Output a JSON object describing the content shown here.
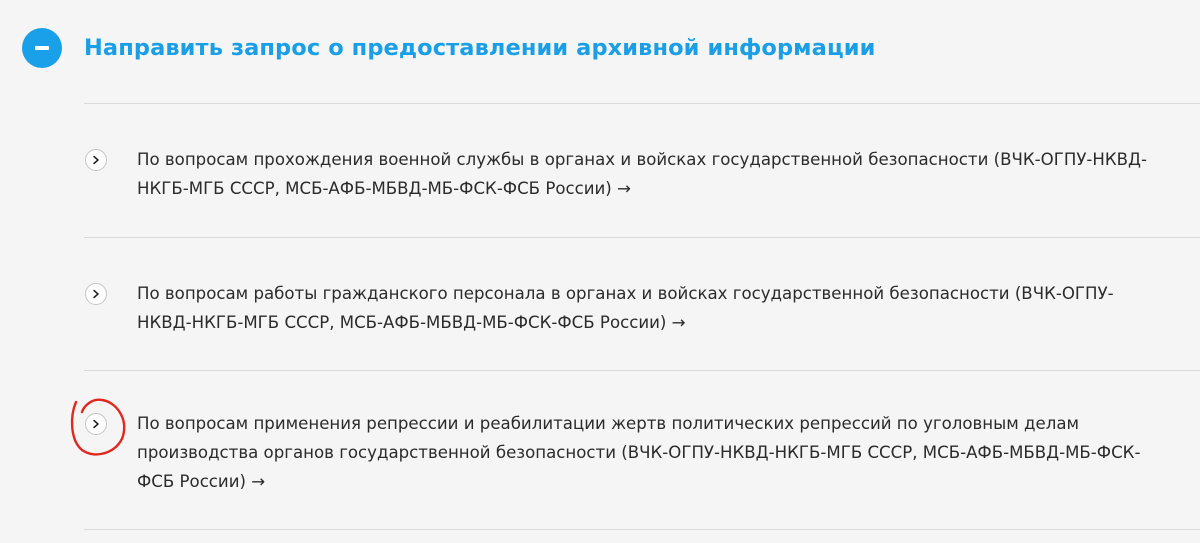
{
  "section": {
    "title": "Направить запрос о предоставлении архивной информации",
    "toggle_icon": "minus-icon",
    "accent_color": "#1a9fe6"
  },
  "items": [
    {
      "text": "По вопросам прохождения военной службы в органах и войсках государственной безопасности (ВЧК-ОГПУ-НКВД-НКГБ-МГБ СССР, МСБ-АФБ-МБВД-МБ-ФСК-ФСБ России) →",
      "icon": "chevron-right-icon"
    },
    {
      "text": "По вопросам работы гражданского персонала в органах и войсках государственной безопасности (ВЧК-ОГПУ-НКВД-НКГБ-МГБ СССР, МСБ-АФБ-МБВД-МБ-ФСК-ФСБ России) →",
      "icon": "chevron-right-icon"
    },
    {
      "text": "По вопросам применения репрессии и реабилитации жертв политических репрессий по уголовным делам производства органов государственной безопасности (ВЧК-ОГПУ-НКВД-НКГБ-МГБ СССР, МСБ-АФБ-МБВД-МБ-ФСК-ФСБ России) →",
      "icon": "chevron-right-icon",
      "highlighted": true
    }
  ],
  "annotation": {
    "icon": "red-circle-annotation",
    "color": "#e0281e"
  }
}
